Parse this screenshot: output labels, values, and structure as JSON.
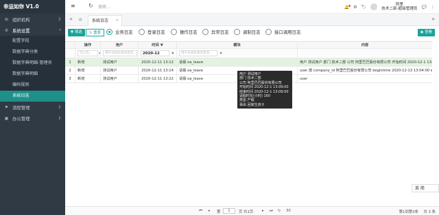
{
  "app": {
    "title": "幸运如你 V1.0"
  },
  "sidebar": {
    "items": [
      {
        "label": "组织机构",
        "icon": "org-icon"
      },
      {
        "label": "系统设置",
        "icon": "gear-icon"
      }
    ],
    "sub_items": [
      "配置字段",
      "数据字典分类",
      "数据字典明细-管理员",
      "数据字典明细",
      "编码规则",
      "系统日志"
    ],
    "bottom_items": [
      {
        "label": "流程管理",
        "icon": "flow-icon"
      },
      {
        "label": "办公管理",
        "icon": "office-icon"
      }
    ]
  },
  "topbar": {
    "search_placeholder": "搜索...",
    "user_line1": "阿里",
    "user_line2": "技术二部-超级管理员"
  },
  "tabs": [
    {
      "label": "系统日志"
    }
  ],
  "toolbar": {
    "filter_label": "筛选",
    "reset_label": "重置",
    "view_label": "查看",
    "radios": [
      "业务日志",
      "登录日志",
      "操作日志",
      "异常日志",
      "调制日志",
      "接口调用日志"
    ]
  },
  "table": {
    "columns": [
      "操作",
      "用户",
      "时间",
      "模块",
      "内容"
    ],
    "filters": {
      "op": "",
      "user": "",
      "time": "2020-12",
      "module": "",
      "content": ""
    },
    "filter_placeholders": {
      "op": "可以包...",
      "user": "用引号括起来的是完...",
      "module": "用引号括起来的是完...",
      "content": ""
    },
    "rows": [
      {
        "idx": "1",
        "op": "新增",
        "user": "测试用户",
        "time": "2020-12-11 13:12",
        "module": "请假 oa_leave",
        "content": "用户 测试用户 部门 技术二部 公司 阿里巴巴股份有限公司 开始时间 2020-12-1 13:09:00 结束时间 2020-12-31 13:09:00 请"
      },
      {
        "idx": "2",
        "op": "新增",
        "user": "测试用户",
        "time": "2020-12-11 13:14",
        "module": "请假 oa_leave",
        "content": "user            部 company_id 阿里巴巴股份有限公司 begintime 2020-12-13 13:04:00 endtime 2021"
      },
      {
        "idx": "3",
        "op": "新增",
        "user": "测试用户",
        "time": "2020-12-11 13:22",
        "module": "请假 oa_leave",
        "content": "user"
      }
    ]
  },
  "tooltip": {
    "lines": [
      "用户 测试用户",
      "部门 技术二部",
      "公司 阿里巴巴股份有限公司",
      "开始时间 2020-12-1 13:09:00",
      "结束时间 2020-12-1 13:09:00",
      "请假时长(小时) 160",
      "类型 产假",
      "事由 回家生孩子"
    ]
  },
  "pager": {
    "page_label": "第",
    "page_value": "1",
    "of_label": "页 共1页",
    "page_size": "30",
    "summary": "第1到第3条",
    "total": "共 3 条"
  },
  "lang_switch": {
    "label": "英 简"
  },
  "colors": {
    "accent": "#1aa39a",
    "sidebar": "#2f3a45",
    "selected_row": "#e3f3e1"
  }
}
